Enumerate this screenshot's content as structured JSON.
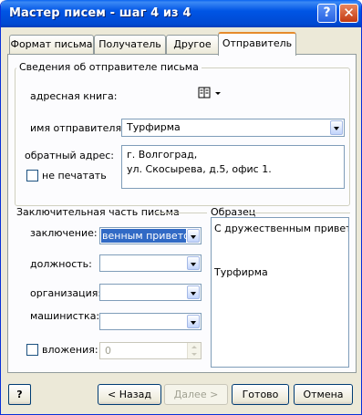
{
  "window": {
    "title": "Мастер писем - шаг 4 из 4",
    "help_glyph": "?",
    "close_glyph": "✕"
  },
  "tabs": [
    {
      "label": "Формат письма"
    },
    {
      "label": "Получатель"
    },
    {
      "label": "Другое"
    },
    {
      "label": "Отправитель"
    }
  ],
  "sender_info": {
    "group_title": "Сведения об отправителе письма",
    "address_book_label": "адресная книга:",
    "sender_name_label": "имя отправителя:",
    "sender_name_value": "Турфирма",
    "return_address_label": "обратный адрес:",
    "return_address_lines": [
      "г. Волгоград,",
      "ул. Скосырева, д.5, офис 1."
    ],
    "no_print_label": "не печатать"
  },
  "closing": {
    "group_title": "Заключительная часть письма",
    "closing_label": "заключение:",
    "closing_value": "венным приветом",
    "position_label": "должность:",
    "organization_label": "организация:",
    "typist_label": "машинистка:",
    "enclosures_label": "вложения:",
    "enclosures_value": "0"
  },
  "preview": {
    "group_title": "Образец",
    "line1": "С дружественным привет",
    "line2": "Турфирма"
  },
  "buttons": {
    "help": "?",
    "back": "< Назад",
    "next": "Далее >",
    "finish": "Готово",
    "cancel": "Отмена"
  },
  "icons": {
    "address_book": "address-book-icon",
    "dropdown": "chevron-down-icon"
  }
}
